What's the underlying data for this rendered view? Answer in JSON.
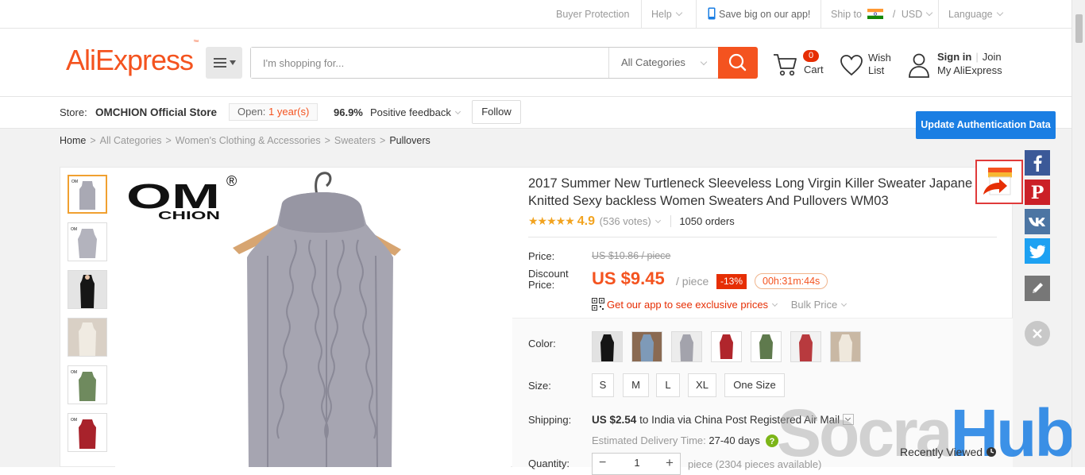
{
  "topbar": {
    "buyer_protection": "Buyer Protection",
    "help": "Help",
    "app_promo": "Save big on our app!",
    "ship_to": "Ship to",
    "currency_sep": "/",
    "currency": "USD",
    "language": "Language"
  },
  "header": {
    "logo": "AliExpress",
    "logo_tm": "™",
    "search_placeholder": "I'm shopping for...",
    "category": "All Categories",
    "cart_count": "0",
    "cart_label": "Cart",
    "wish_line1": "Wish",
    "wish_line2": "List",
    "sign_in": "Sign in",
    "sep": "|",
    "join": "Join",
    "my_aliexpress": "My AliExpress"
  },
  "store": {
    "label": "Store:",
    "name": "OMCHION Official Store",
    "open_label": "Open:",
    "open_value": "1 year(s)",
    "feedback_pct": "96.9%",
    "feedback_label": "Positive feedback",
    "follow": "Follow"
  },
  "breadcrumb": [
    "Home",
    "All Categories",
    "Women's Clothing & Accessories",
    "Sweaters",
    "Pullovers"
  ],
  "auth_button": "Update Authentication Data",
  "product": {
    "brand_logo": "OMCHION",
    "registered_mark": "®",
    "title_line1": "2017 Summer New Turtleneck Sleeveless Long Virgin Killer Sweater Japanese",
    "title_line2": "Knitted Sexy backless Women Sweaters And Pullovers WM03",
    "stars": "★★★★★",
    "rating": "4.9",
    "votes": "(536 votes)",
    "orders": "1050 orders",
    "price_label": "Price:",
    "old_price": "US $10.86 / piece",
    "discount_label_1": "Discount",
    "discount_label_2": "Price:",
    "price": "US $9.45",
    "per_piece": "/ piece",
    "discount": "-13%",
    "timer": "00h:31m:44s",
    "app_prices": "Get our app to see exclusive prices",
    "bulk_price": "Bulk Price",
    "color_label": "Color:",
    "size_label": "Size:",
    "sizes": [
      "S",
      "M",
      "L",
      "XL",
      "One Size"
    ],
    "shipping_label": "Shipping:",
    "shipping_price": "US $2.54",
    "shipping_rest": "to India via China Post Registered Air Mail",
    "delivery_label": "Estimated Delivery Time:",
    "delivery_value": "27-40 days",
    "quantity_label": "Quantity:",
    "quantity": "1",
    "qty_minus": "−",
    "qty_plus": "+",
    "pieces_available": "piece (2304 pieces available)"
  },
  "colors": {
    "accent": "#f4531f",
    "discount_red": "#e62e04",
    "auth_blue": "#1a7ee3",
    "facebook": "#3b5998",
    "pinterest": "#cb2027",
    "vk": "#4c75a3",
    "twitter": "#1da1f2"
  },
  "sidebar": {
    "recently_viewed": "Recently Viewed",
    "icons": [
      "facebook-icon",
      "pinterest-icon",
      "vk-icon",
      "twitter-icon",
      "pencil-icon",
      "close-icon"
    ]
  },
  "watermark": {
    "part1": "Socra",
    "part2": "Hub"
  }
}
